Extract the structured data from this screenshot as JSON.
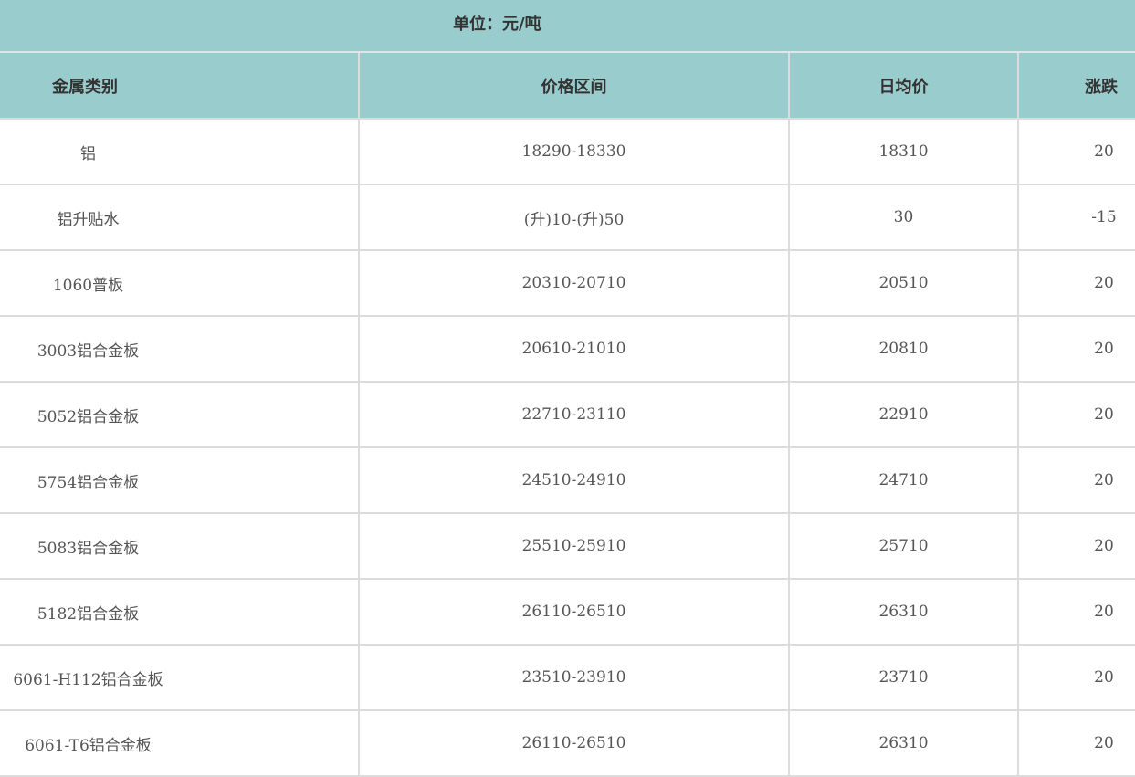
{
  "unit_label": "单位：元/吨",
  "headers": {
    "metal": "金属类别",
    "range": "价格区间",
    "avg": "日均价",
    "change": "涨跌"
  },
  "rows": [
    {
      "metal": "铝",
      "range": "18290-18330",
      "avg": "18310",
      "change": "20"
    },
    {
      "metal": "铝升贴水",
      "range": "(升)10-(升)50",
      "avg": "30",
      "change": "-15"
    },
    {
      "metal": "1060普板",
      "range": "20310-20710",
      "avg": "20510",
      "change": "20"
    },
    {
      "metal": "3003铝合金板",
      "range": "20610-21010",
      "avg": "20810",
      "change": "20"
    },
    {
      "metal": "5052铝合金板",
      "range": "22710-23110",
      "avg": "22910",
      "change": "20"
    },
    {
      "metal": "5754铝合金板",
      "range": "24510-24910",
      "avg": "24710",
      "change": "20"
    },
    {
      "metal": "5083铝合金板",
      "range": "25510-25910",
      "avg": "25710",
      "change": "20"
    },
    {
      "metal": "5182铝合金板",
      "range": "26110-26510",
      "avg": "26310",
      "change": "20"
    },
    {
      "metal": "6061-H112铝合金板",
      "range": "23510-23910",
      "avg": "23710",
      "change": "20"
    },
    {
      "metal": "6061-T6铝合金板",
      "range": "26110-26510",
      "avg": "26310",
      "change": "20"
    }
  ],
  "colors": {
    "header_bg": "#99cccc",
    "border": "#dcdcdc",
    "body_bg": "#ffffff"
  }
}
